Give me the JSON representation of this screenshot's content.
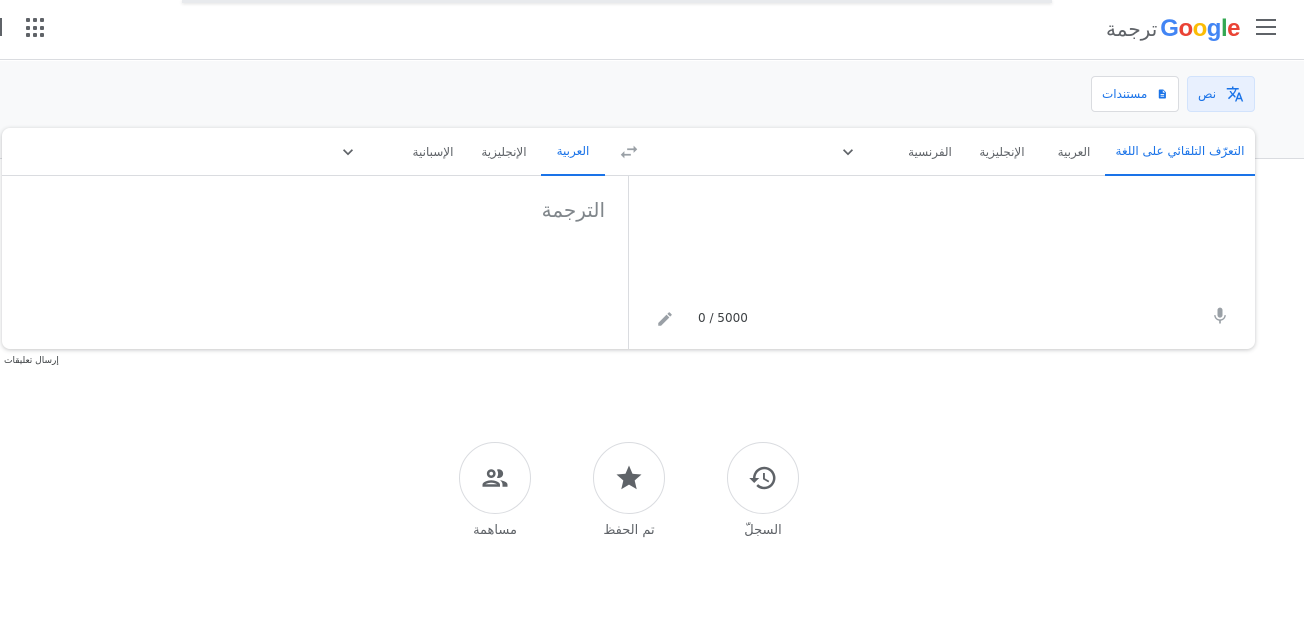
{
  "header": {
    "logo_text": "Google",
    "app_name": "ترجمة",
    "brand_colors": [
      "#4285F4",
      "#EA4335",
      "#FBBC05",
      "#4285F4",
      "#34A853",
      "#EA4335"
    ]
  },
  "modes": {
    "text_label": "نص",
    "documents_label": "مستندات"
  },
  "source_langs": {
    "detect": "التعرّف التلقائي على اللغة",
    "lang1": "العربية",
    "lang2": "الإنجليزية",
    "lang3": "الفرنسية"
  },
  "target_langs": {
    "lang1": "العربية",
    "lang2": "الإنجليزية",
    "lang3": "الإسبانية"
  },
  "translation": {
    "placeholder": "الترجمة"
  },
  "source": {
    "char_counter": "0 / 5000"
  },
  "feedback_text": "إرسال تعليقات",
  "quick_actions": {
    "history": "السجلّ",
    "saved": "تم الحفظ",
    "contribute": "مساهمة"
  },
  "colors": {
    "accent": "#1a73e8",
    "active_bg": "#e8f0fe",
    "icon_gray": "#5f6368"
  }
}
